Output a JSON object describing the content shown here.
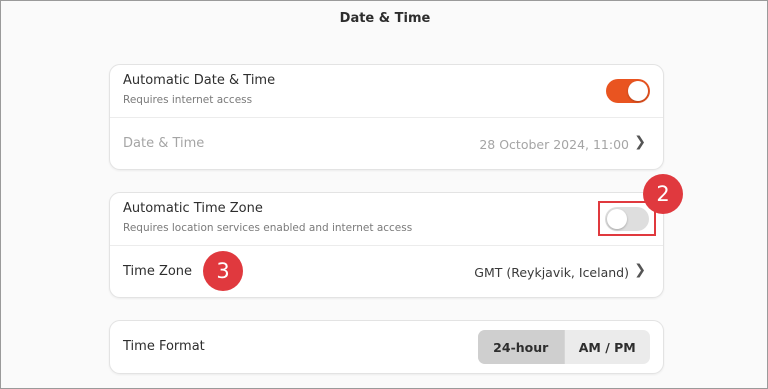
{
  "window": {
    "title": "Date & Time"
  },
  "datetime_card": {
    "auto_datetime": {
      "label": "Automatic Date & Time",
      "subtitle": "Requires internet access",
      "enabled": true
    },
    "datetime": {
      "label": "Date & Time",
      "value": "28 October 2024, 11:00"
    }
  },
  "timezone_card": {
    "auto_timezone": {
      "label": "Automatic Time Zone",
      "subtitle": "Requires location services enabled and internet access",
      "enabled": false
    },
    "timezone": {
      "label": "Time Zone",
      "value": "GMT (Reykjavik, Iceland)"
    }
  },
  "format_card": {
    "time_format": {
      "label": "Time Format",
      "options": [
        "24-hour",
        "AM / PM"
      ],
      "selected": "24-hour"
    }
  },
  "annotations": {
    "badge_2": "2",
    "badge_3": "3"
  },
  "icons": {
    "chevron": "chevron-right-icon"
  },
  "colors": {
    "accent": "#e95420",
    "annotation": "#e0393e"
  }
}
